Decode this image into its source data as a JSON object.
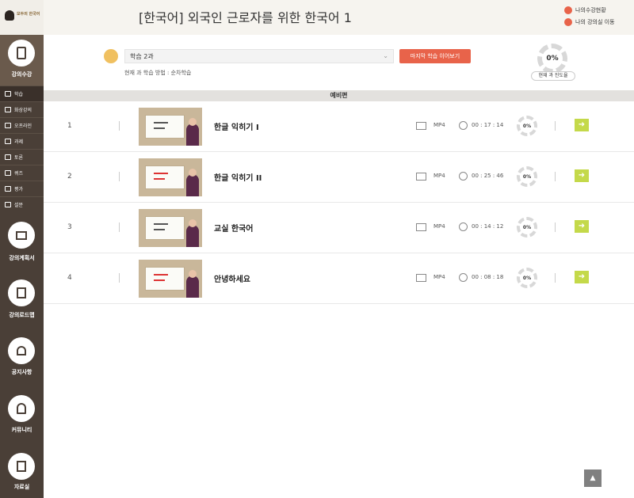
{
  "logo": {
    "text": "모두의 한국어"
  },
  "header": {
    "title": "[한국어] 외국인 근로자를 위한 한국어 1",
    "link_status": "나의수강현황",
    "link_classroom": "나의 강의실 이동"
  },
  "sidebar": {
    "course_label": "강의수강",
    "submenu": [
      {
        "label": "학습",
        "active": true
      },
      {
        "label": "화상강의",
        "active": false
      },
      {
        "label": "오프라인",
        "active": false
      },
      {
        "label": "과제",
        "active": false
      },
      {
        "label": "토론",
        "active": false
      },
      {
        "label": "퀴즈",
        "active": false
      },
      {
        "label": "평가",
        "active": false
      },
      {
        "label": "설문",
        "active": false
      }
    ],
    "big_items": [
      {
        "label": "강의계획서",
        "icon": "monitor-icon"
      },
      {
        "label": "강의로드맵",
        "icon": "book-icon"
      },
      {
        "label": "공지사항",
        "icon": "bell-icon"
      },
      {
        "label": "커뮤니티",
        "icon": "user-icon"
      },
      {
        "label": "자료실",
        "icon": "folder-icon"
      }
    ]
  },
  "controls": {
    "select_value": "학습 2과",
    "resume_label": "마지막 학습 이어보기",
    "method_text": "현재 과 학습 방법 : 순차학습",
    "progress_value": "0%",
    "progress_label": "현재 과 진도율"
  },
  "section": {
    "title": "예비편"
  },
  "lessons": [
    {
      "num": "1",
      "title": "한글 익히기 I",
      "format": "MP4",
      "duration": "00 : 17 : 14",
      "progress": "0%"
    },
    {
      "num": "2",
      "title": "한글 익히기 II",
      "format": "MP4",
      "duration": "00 : 25 : 46",
      "progress": "0%"
    },
    {
      "num": "3",
      "title": "교실 한국어",
      "format": "MP4",
      "duration": "00 : 14 : 12",
      "progress": "0%"
    },
    {
      "num": "4",
      "title": "안녕하세요",
      "format": "MP4",
      "duration": "00 : 08 : 18",
      "progress": "0%"
    }
  ]
}
